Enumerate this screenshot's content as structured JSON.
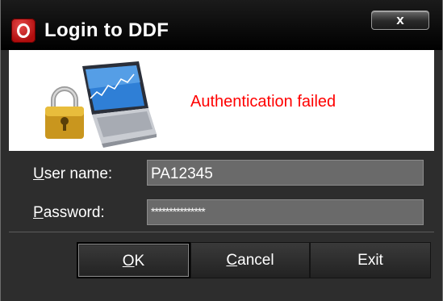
{
  "window": {
    "title": "Login to DDF",
    "close_label": "x"
  },
  "banner": {
    "status_text": "Authentication failed",
    "status_color": "#ff0000",
    "icon": "locked-laptop-icon"
  },
  "form": {
    "username_label_accel": "U",
    "username_label_rest": "ser name:",
    "username_value": "PA12345",
    "password_label_accel": "P",
    "password_label_rest": "assword:",
    "password_value": "***************"
  },
  "buttons": {
    "ok_accel": "O",
    "ok_rest": "K",
    "cancel_accel": "C",
    "cancel_rest": "ancel",
    "exit_label": "Exit"
  },
  "colors": {
    "background": "#2d2d2d",
    "titlebar": "#000000",
    "accent_logo": "#c0161a"
  }
}
